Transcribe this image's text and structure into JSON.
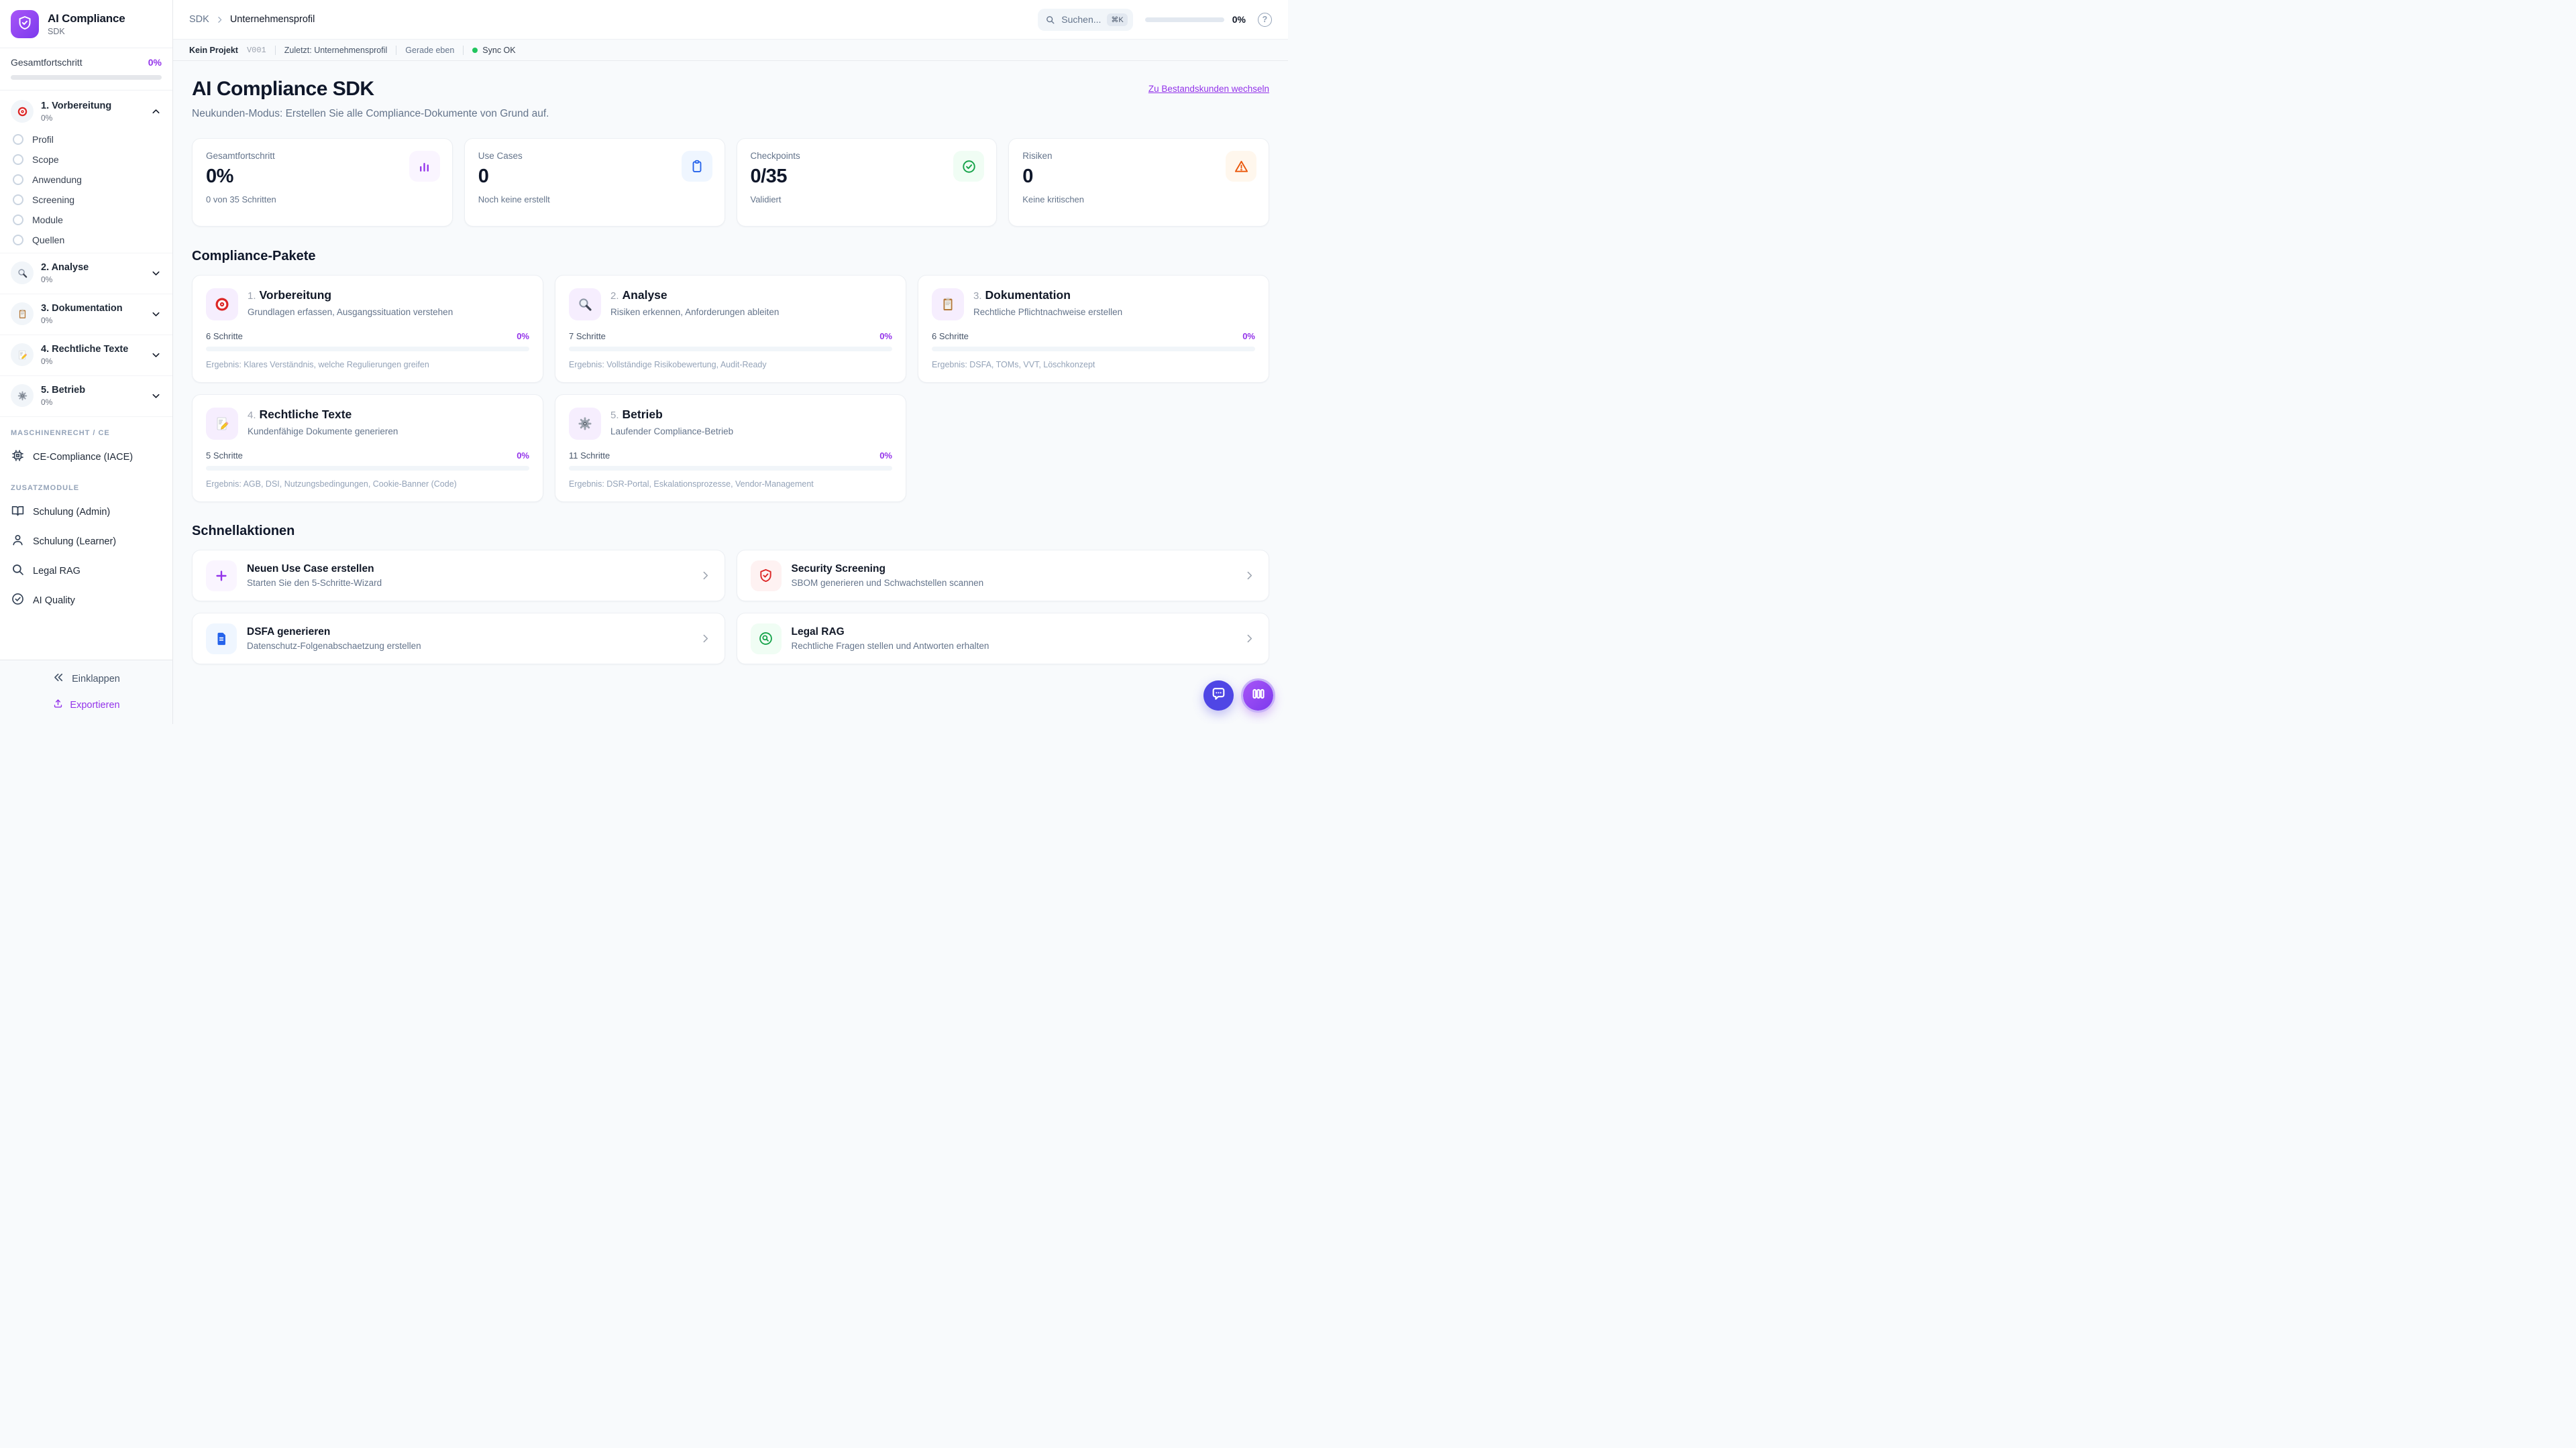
{
  "colors": {
    "accent_purple": "#9333ea",
    "logo_gradient": [
      "#a855f7",
      "#7c3aed"
    ],
    "sync_green": "#22c55e",
    "stat_icon_purple": "#9333ea",
    "stat_icon_blue": "#2563eb",
    "stat_icon_green": "#16a34a",
    "stat_icon_orange": "#ea580c",
    "action_red": "#dc2626",
    "fab_indigo": "#4f46e5"
  },
  "sidebar": {
    "logo_title": "AI Compliance",
    "logo_subtitle": "SDK",
    "progress_label": "Gesamtfortschritt",
    "progress_value": "0%",
    "steps": [
      {
        "label": "1. Vorbereitung",
        "percent": "0%",
        "icon": "target-icon",
        "expanded": true,
        "substeps": [
          "Profil",
          "Scope",
          "Anwendung",
          "Screening",
          "Module",
          "Quellen"
        ]
      },
      {
        "label": "2. Analyse",
        "percent": "0%",
        "icon": "magnifier-icon",
        "expanded": false
      },
      {
        "label": "3. Dokumentation",
        "percent": "0%",
        "icon": "clipboard-icon",
        "expanded": false
      },
      {
        "label": "4. Rechtliche Texte",
        "percent": "0%",
        "icon": "memo-icon",
        "expanded": false
      },
      {
        "label": "5. Betrieb",
        "percent": "0%",
        "icon": "gear-icon",
        "expanded": false
      }
    ],
    "sections": [
      {
        "header": "MASCHINENRECHT / CE",
        "items": [
          {
            "label": "CE-Compliance (IACE)",
            "icon": "cpu-icon"
          }
        ]
      },
      {
        "header": "ZUSATZMODULE",
        "items": [
          {
            "label": "Schulung (Admin)",
            "icon": "book-icon"
          },
          {
            "label": "Schulung (Learner)",
            "icon": "user-icon"
          },
          {
            "label": "Legal RAG",
            "icon": "search-icon"
          },
          {
            "label": "AI Quality",
            "icon": "check-circle-icon"
          }
        ]
      }
    ],
    "collapse_label": "Einklappen",
    "export_label": "Exportieren"
  },
  "topbar": {
    "breadcrumb": {
      "root": "SDK",
      "current": "Unternehmensprofil"
    },
    "search_placeholder": "Suchen...",
    "search_shortcut": "⌘K",
    "progress_value": "0%",
    "help_glyph": "?"
  },
  "statusbar": {
    "project": "Kein Projekt",
    "version": "V001",
    "last_edited": "Zuletzt: Unternehmensprofil",
    "time": "Gerade eben",
    "sync": "Sync OK"
  },
  "main": {
    "title": "AI Compliance SDK",
    "subtitle": "Neukunden-Modus: Erstellen Sie alle Compliance-Dokumente von Grund auf.",
    "switch_link": "Zu Bestandskunden wechseln",
    "stats": [
      {
        "label": "Gesamtfortschritt",
        "value": "0%",
        "sub": "0 von 35 Schritten",
        "icon": "bar-chart-icon"
      },
      {
        "label": "Use Cases",
        "value": "0",
        "sub": "Noch keine erstellt",
        "icon": "clipboard-icon"
      },
      {
        "label": "Checkpoints",
        "value": "0/35",
        "sub": "Validiert",
        "icon": "check-circle-icon"
      },
      {
        "label": "Risiken",
        "value": "0",
        "sub": "Keine kritischen",
        "icon": "warning-icon"
      }
    ],
    "packages_heading": "Compliance-Pakete",
    "packages": [
      {
        "number": "1.",
        "title": "Vorbereitung",
        "description": "Grundlagen erfassen, Ausgangssituation verstehen",
        "steps": "6 Schritte",
        "percent": "0%",
        "result": "Ergebnis: Klares Verständnis, welche Regulierungen greifen",
        "icon": "target-icon"
      },
      {
        "number": "2.",
        "title": "Analyse",
        "description": "Risiken erkennen, Anforderungen ableiten",
        "steps": "7 Schritte",
        "percent": "0%",
        "result": "Ergebnis: Vollständige Risikobewertung, Audit-Ready",
        "icon": "magnifier-icon"
      },
      {
        "number": "3.",
        "title": "Dokumentation",
        "description": "Rechtliche Pflichtnachweise erstellen",
        "steps": "6 Schritte",
        "percent": "0%",
        "result": "Ergebnis: DSFA, TOMs, VVT, Löschkonzept",
        "icon": "clipboard-icon"
      },
      {
        "number": "4.",
        "title": "Rechtliche Texte",
        "description": "Kundenfähige Dokumente generieren",
        "steps": "5 Schritte",
        "percent": "0%",
        "result": "Ergebnis: AGB, DSI, Nutzungsbedingungen, Cookie-Banner (Code)",
        "icon": "memo-icon"
      },
      {
        "number": "5.",
        "title": "Betrieb",
        "description": "Laufender Compliance-Betrieb",
        "steps": "11 Schritte",
        "percent": "0%",
        "result": "Ergebnis: DSR-Portal, Eskalationsprozesse, Vendor-Management",
        "icon": "gear-icon"
      }
    ],
    "quick_heading": "Schnellaktionen",
    "quick_actions": [
      {
        "title": "Neuen Use Case erstellen",
        "subtitle": "Starten Sie den 5-Schritte-Wizard",
        "icon": "plus-icon"
      },
      {
        "title": "Security Screening",
        "subtitle": "SBOM generieren und Schwachstellen scannen",
        "icon": "shield-check-icon"
      },
      {
        "title": "DSFA generieren",
        "subtitle": "Datenschutz-Folgenabschaetzung erstellen",
        "icon": "document-icon"
      },
      {
        "title": "Legal RAG",
        "subtitle": "Rechtliche Fragen stellen und Antworten erhalten",
        "icon": "search-circle-icon"
      }
    ]
  }
}
